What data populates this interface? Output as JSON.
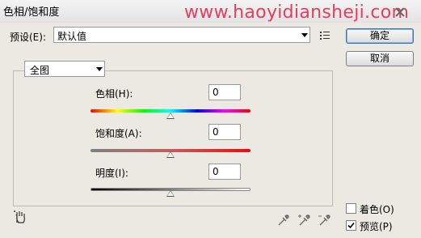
{
  "window": {
    "title": "色相/饱和度",
    "watermark": "www.haoyidiansheji.com"
  },
  "preset": {
    "label": "预设(E):",
    "value": "默认值"
  },
  "buttons": {
    "ok": "确定",
    "cancel": "取消"
  },
  "channel": {
    "value": "全图"
  },
  "sliders": {
    "hue": {
      "label": "色相(H):",
      "value": "0"
    },
    "saturation": {
      "label": "饱和度(A):",
      "value": "0"
    },
    "lightness": {
      "label": "明度(I):",
      "value": "0"
    }
  },
  "options": {
    "colorize": {
      "label": "着色(O)",
      "checked": false
    },
    "preview": {
      "label": "预览(P)",
      "checked": true
    }
  }
}
